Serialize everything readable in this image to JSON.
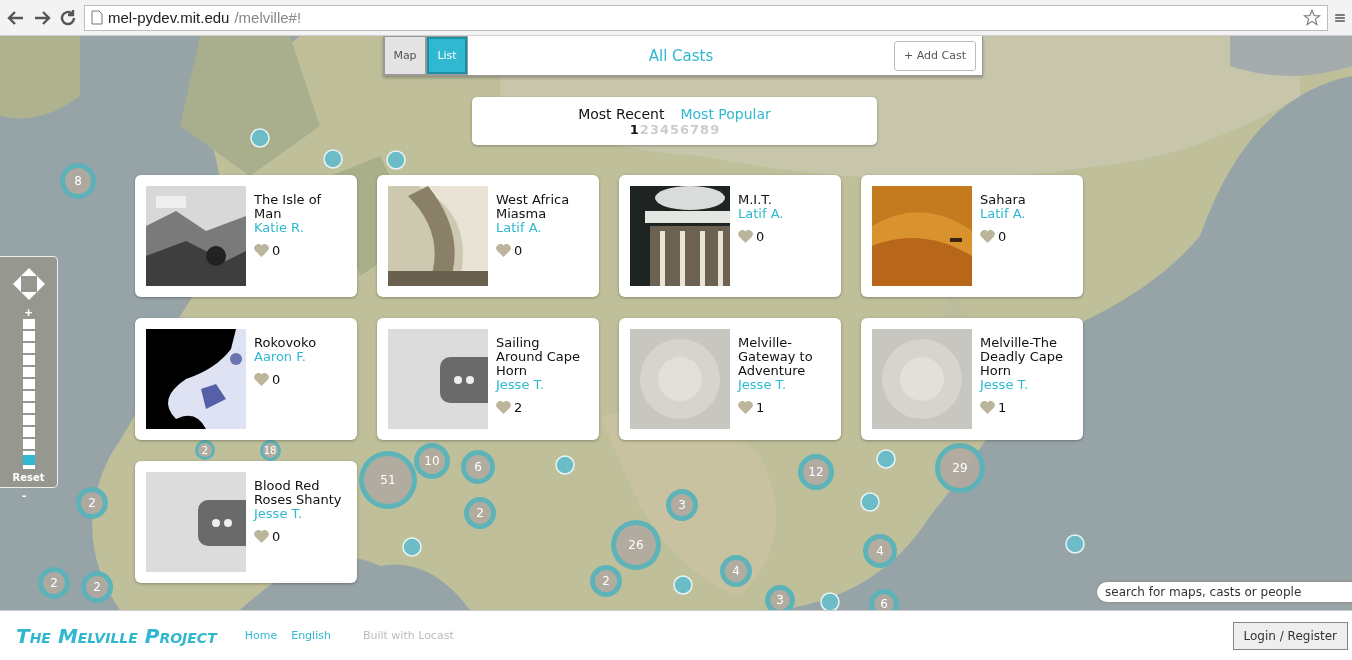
{
  "browser": {
    "url_host": "mel-pydev.mit.edu",
    "url_path": "/melville#!"
  },
  "toolbar": {
    "views": [
      {
        "label": "Map",
        "selected": false
      },
      {
        "label": "List",
        "selected": true
      }
    ],
    "title": "All Casts",
    "add_button": "+ Add Cast"
  },
  "sort": {
    "options": [
      {
        "label": "Most Recent",
        "selected": true
      },
      {
        "label": "Most Popular",
        "selected": false
      }
    ],
    "pages": [
      {
        "label": "1",
        "selected": true
      },
      {
        "label": "2",
        "selected": false
      },
      {
        "label": "3",
        "selected": false
      },
      {
        "label": "4",
        "selected": false
      },
      {
        "label": "5",
        "selected": false
      },
      {
        "label": "6",
        "selected": false
      },
      {
        "label": "7",
        "selected": false
      },
      {
        "label": "8",
        "selected": false
      },
      {
        "label": "9",
        "selected": false
      }
    ]
  },
  "casts": [
    {
      "title": "The Isle of Man",
      "author": "Katie R.",
      "likes": "0"
    },
    {
      "title": "West Africa Miasma",
      "author": "Latif A.",
      "likes": "0"
    },
    {
      "title": "M.I.T.",
      "author": "Latif A.",
      "likes": "0"
    },
    {
      "title": "Sahara",
      "author": "Latif A.",
      "likes": "0"
    },
    {
      "title": "Rokovoko",
      "author": "Aaron F.",
      "likes": "0"
    },
    {
      "title": "Sailing Around Cape Horn",
      "author": "Jesse T.",
      "likes": "2"
    },
    {
      "title": "Melville-Gateway to Adventure",
      "author": "Jesse T.",
      "likes": "1"
    },
    {
      "title": "Melville-The Deadly Cape Horn",
      "author": "Jesse T.",
      "likes": "1"
    },
    {
      "title": "Blood Red Roses Shanty",
      "author": "Jesse T.",
      "likes": "0"
    }
  ],
  "map_controls": {
    "zoom_in": "+",
    "reset": "Reset",
    "zoom_out": "-",
    "zoom": {
      "level": 0.06
    }
  },
  "map_clusters": [
    {
      "count": "8"
    },
    {
      "count": "2"
    },
    {
      "count": "2"
    },
    {
      "count": "2"
    },
    {
      "count": "51"
    },
    {
      "count": "10"
    },
    {
      "count": "6"
    },
    {
      "count": "2"
    },
    {
      "count": "2"
    },
    {
      "count": "18"
    },
    {
      "count": "3"
    },
    {
      "count": "26"
    },
    {
      "count": "2"
    },
    {
      "count": "4"
    },
    {
      "count": "4"
    },
    {
      "count": "12"
    },
    {
      "count": "29"
    },
    {
      "count": "3"
    },
    {
      "count": "6"
    }
  ],
  "search": {
    "placeholder": "search for maps, casts or people"
  },
  "footer": {
    "logo": "The Melville Project",
    "links": [
      "Home",
      "English"
    ],
    "credit": "Built with Locast",
    "login": "Login / Register"
  }
}
